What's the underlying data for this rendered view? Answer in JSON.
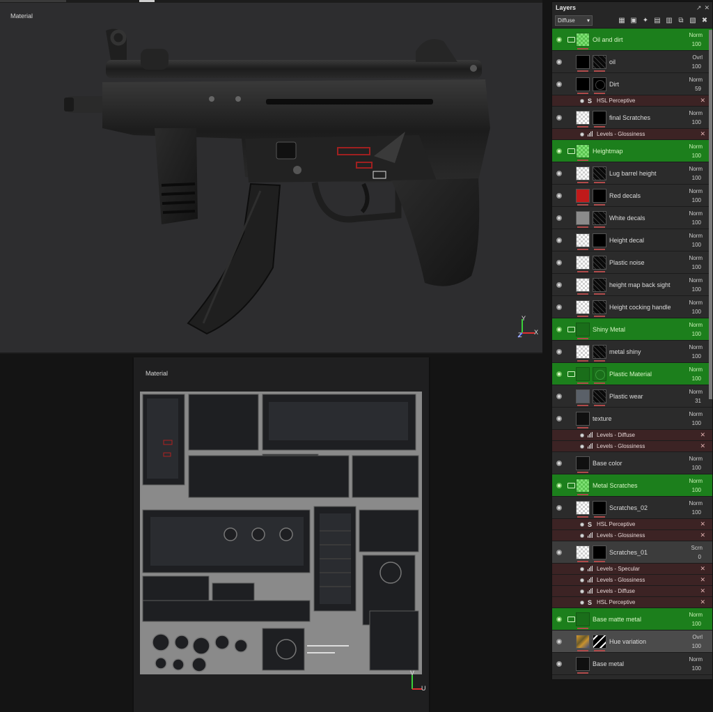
{
  "viewport3d": {
    "label": "Material",
    "axes": {
      "y": "Y",
      "x": "X",
      "z": "Z"
    }
  },
  "viewport_uv": {
    "label": "Material",
    "axes": {
      "v": "V",
      "u": "U"
    }
  },
  "layers_panel": {
    "title": "Layers",
    "channel": "Diffuse",
    "header_icons": [
      "detach-icon",
      "close-icon"
    ],
    "toolbar_icons": [
      "add-layer-icon",
      "add-mask-icon",
      "add-effect-icon",
      "add-fill-icon",
      "add-folder-icon",
      "duplicate-icon",
      "import-icon",
      "delete-icon"
    ],
    "rows": [
      {
        "kind": "folder",
        "name": "Oil and dirt",
        "blend": "Norm",
        "opacity": "100",
        "thumb": "checker-green"
      },
      {
        "kind": "layer",
        "name": "oil",
        "blend": "Ovrl",
        "opacity": "100",
        "thumb": "black",
        "mask": "noise"
      },
      {
        "kind": "layer",
        "name": "Dirt",
        "blend": "Norm",
        "opacity": "59",
        "thumb": "black",
        "mask": "ring"
      },
      {
        "kind": "effect",
        "name": "HSL Perceptive",
        "icon": "hsl"
      },
      {
        "kind": "layer",
        "name": "final Scratches",
        "blend": "Norm",
        "opacity": "100",
        "thumb": "checker",
        "mask": "black"
      },
      {
        "kind": "effect",
        "name": "Levels - Glossiness",
        "icon": "levels"
      },
      {
        "kind": "folder",
        "name": "Heightmap",
        "blend": "Norm",
        "opacity": "100",
        "thumb": "checker-green"
      },
      {
        "kind": "layer",
        "name": "Lug barrel height",
        "blend": "Norm",
        "opacity": "100",
        "thumb": "checker",
        "mask": "noise"
      },
      {
        "kind": "layer",
        "name": "Red decals",
        "blend": "Norm",
        "opacity": "100",
        "thumb": "red",
        "mask": "black"
      },
      {
        "kind": "layer",
        "name": "White decals",
        "blend": "Norm",
        "opacity": "100",
        "thumb": "grey",
        "mask": "noise"
      },
      {
        "kind": "layer",
        "name": "Height decal",
        "blend": "Norm",
        "opacity": "100",
        "thumb": "checker",
        "mask": "black"
      },
      {
        "kind": "layer",
        "name": "Plastic noise",
        "blend": "Norm",
        "opacity": "100",
        "thumb": "checker",
        "mask": "noise"
      },
      {
        "kind": "layer",
        "name": "height map back sight",
        "blend": "Norm",
        "opacity": "100",
        "thumb": "checker",
        "mask": "noise"
      },
      {
        "kind": "layer",
        "name": "Height cocking handle",
        "blend": "Norm",
        "opacity": "100",
        "thumb": "checker",
        "mask": "noise"
      },
      {
        "kind": "folder",
        "name": "Shiny Metal",
        "blend": "Norm",
        "opacity": "100",
        "thumb": "darkgreen"
      },
      {
        "kind": "layer",
        "name": "metal shiny",
        "blend": "Norm",
        "opacity": "100",
        "thumb": "checker",
        "mask": "noise"
      },
      {
        "kind": "folder",
        "name": "Plastic Material",
        "blend": "Norm",
        "opacity": "100",
        "thumb": "darkgreen",
        "mask": "ring-green"
      },
      {
        "kind": "layer",
        "name": "Plastic wear",
        "blend": "Norm",
        "opacity": "31",
        "thumb": "slate",
        "mask": "noise"
      },
      {
        "kind": "layer",
        "name": "texture",
        "blend": "Norm",
        "opacity": "100",
        "thumb": "nearblack"
      },
      {
        "kind": "effect",
        "name": "Levels - Diffuse",
        "icon": "levels"
      },
      {
        "kind": "effect",
        "name": "Levels - Glossiness",
        "icon": "levels"
      },
      {
        "kind": "layer",
        "name": "Base color",
        "blend": "Norm",
        "opacity": "100",
        "thumb": "nearblack"
      },
      {
        "kind": "folder",
        "name": "Metal Scratches",
        "blend": "Norm",
        "opacity": "100",
        "thumb": "checker-green"
      },
      {
        "kind": "layer",
        "name": "Scratches_02",
        "blend": "Norm",
        "opacity": "100",
        "thumb": "checker",
        "mask": "black"
      },
      {
        "kind": "effect",
        "name": "HSL Perceptive",
        "icon": "hsl"
      },
      {
        "kind": "effect",
        "name": "Levels - Glossiness",
        "icon": "levels"
      },
      {
        "kind": "layer",
        "name": "Scratches_01",
        "blend": "Scrn",
        "opacity": "0",
        "thumb": "checker",
        "mask": "black",
        "state": "light"
      },
      {
        "kind": "effect",
        "name": "Levels - Specular",
        "icon": "levels"
      },
      {
        "kind": "effect",
        "name": "Levels - Glossiness",
        "icon": "levels"
      },
      {
        "kind": "effect",
        "name": "Levels - Diffuse",
        "icon": "levels"
      },
      {
        "kind": "effect",
        "name": "HSL Perceptive",
        "icon": "hsl"
      },
      {
        "kind": "folder",
        "name": "Base matte metal",
        "blend": "Norm",
        "opacity": "100",
        "thumb": "darkgreen"
      },
      {
        "kind": "layer",
        "name": "Hue variation",
        "blend": "Ovrl",
        "opacity": "100",
        "thumb": "hue",
        "mask": "hue2",
        "state": "selected"
      },
      {
        "kind": "layer",
        "name": "Base metal",
        "blend": "Norm",
        "opacity": "100",
        "thumb": "nearblack"
      }
    ]
  }
}
